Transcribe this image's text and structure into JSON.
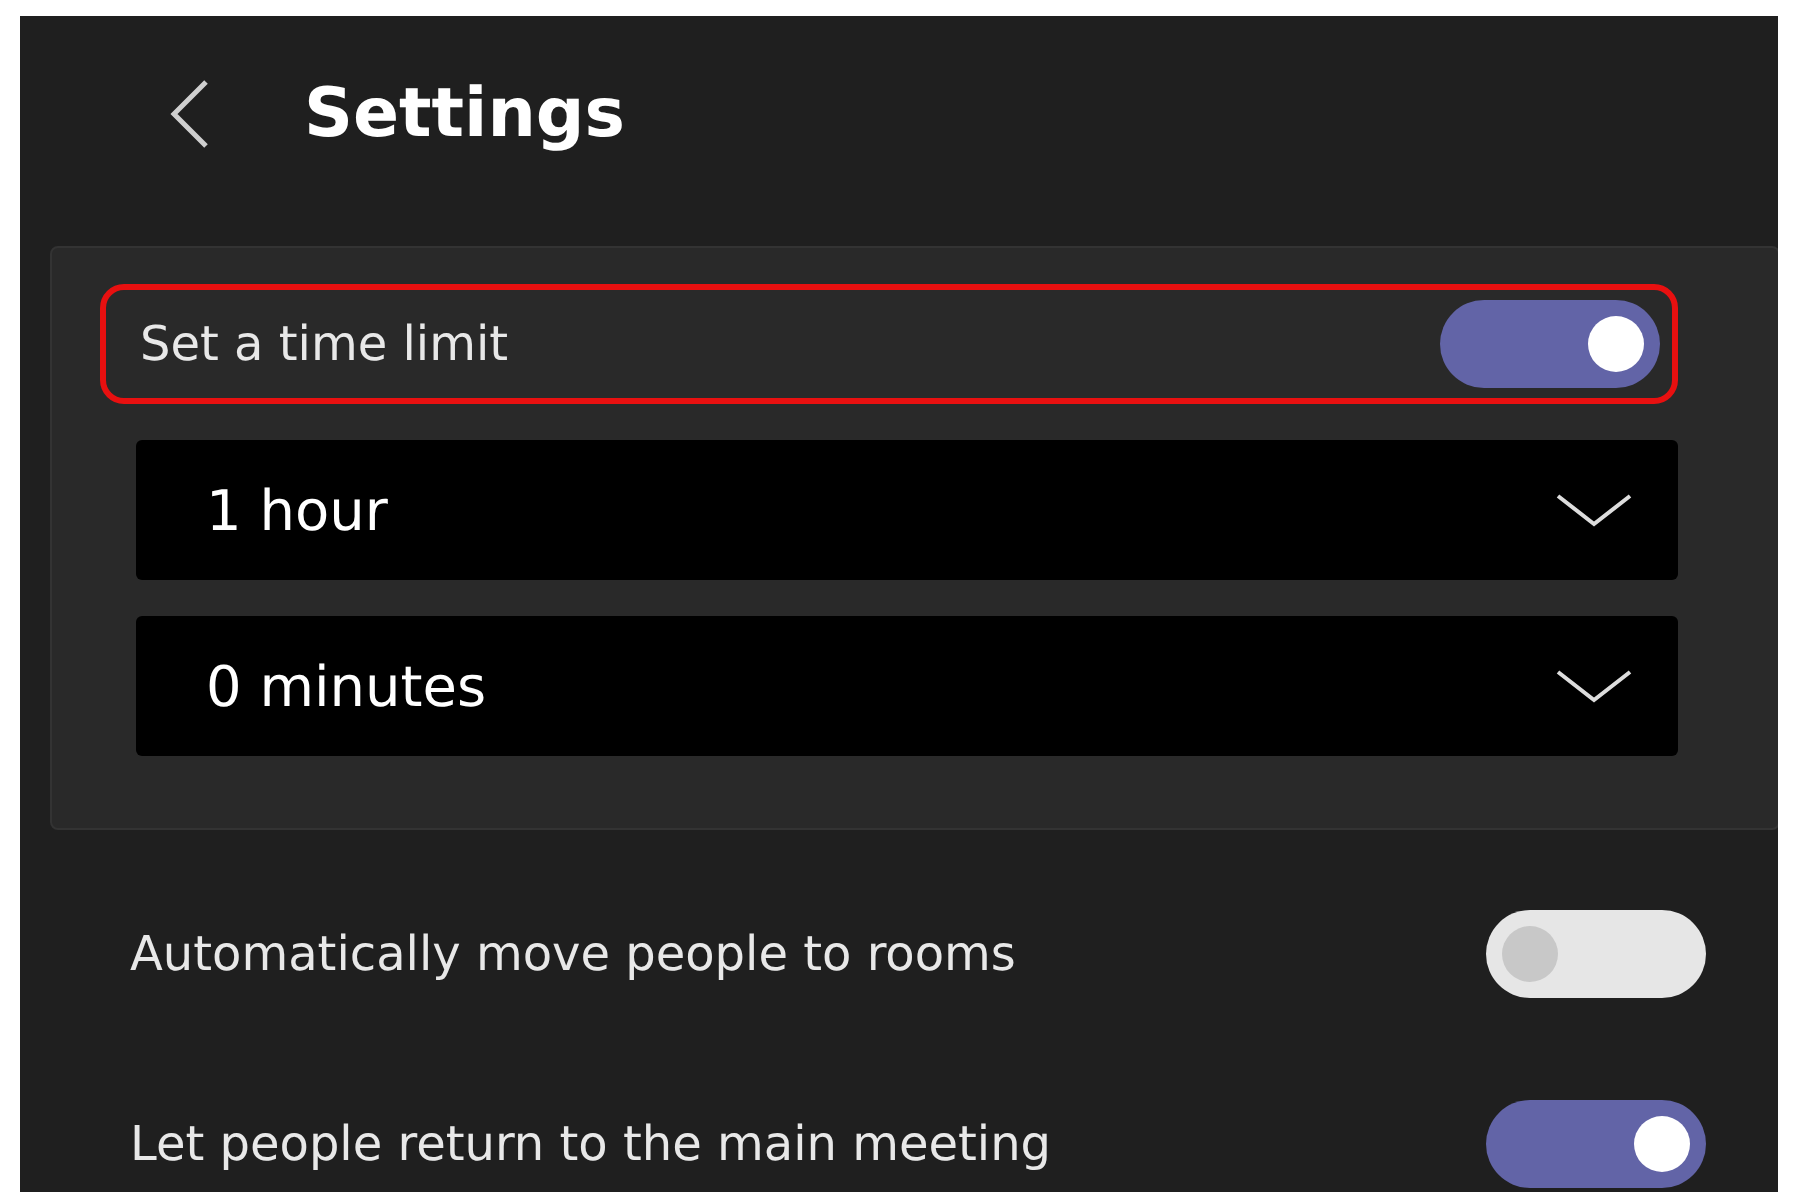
{
  "header": {
    "title": "Settings"
  },
  "time_limit": {
    "label": "Set a time limit",
    "on": true,
    "highlighted": true,
    "dropdowns": [
      {
        "value": "1 hour"
      },
      {
        "value": "0 minutes"
      }
    ]
  },
  "options": [
    {
      "label": "Automatically move people to rooms",
      "on": false
    },
    {
      "label": "Let people return to the main meeting",
      "on": true
    }
  ]
}
